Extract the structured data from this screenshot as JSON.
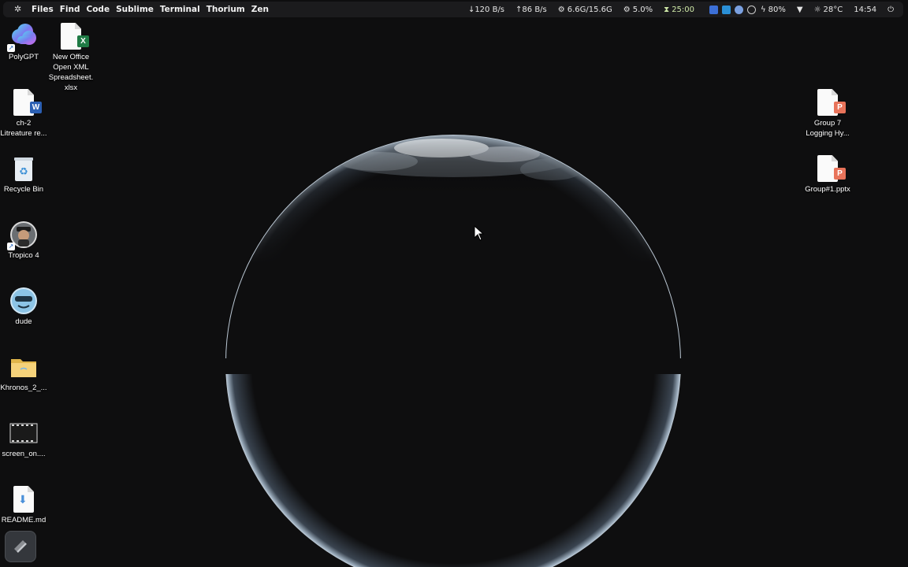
{
  "topbar": {
    "menu": [
      "Files",
      "Find",
      "Code",
      "Sublime",
      "Terminal",
      "Thorium",
      "Zen"
    ],
    "net_down": "↓120 B/s",
    "net_up": "↑86 B/s",
    "memory": "6.6G/15.6G",
    "cpu": "5.0%",
    "timer": "25:00",
    "battery": "80%",
    "weather": "28°C",
    "clock": "14:54"
  },
  "desktop_icons": {
    "polygpt": "PolyGPT",
    "spreadsheet": "New Office\nOpen XML\nSpreadsheet.\nxlsx",
    "ch2": "ch-2\nLitreature re...",
    "recycle": "Recycle Bin",
    "tropico": "Tropico 4",
    "dude": "dude",
    "khronos": "Khronos_2_...",
    "screen": "screen_on....",
    "readme": "README.md",
    "group7": "Group 7\nLogging Hy...",
    "group1": "Group#1.pptx"
  },
  "colors": {
    "topbar_bg": "#1b1b1d",
    "desktop_bg": "#0e0e0f",
    "excel_green": "#1f7a45",
    "word_blue": "#2b5fb3",
    "ppt_orange": "#e8735a"
  }
}
